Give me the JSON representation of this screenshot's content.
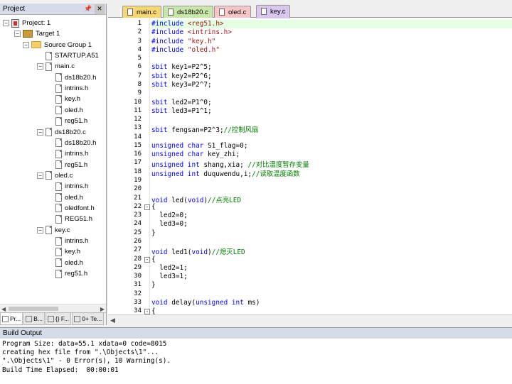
{
  "project_panel": {
    "title": "Project",
    "pin_icon": "pin-icon",
    "close_label": "✕",
    "tree": [
      {
        "label": "Project: 1",
        "type": "project",
        "level": 0,
        "expanded": true
      },
      {
        "label": "Target 1",
        "type": "target",
        "level": 1,
        "expanded": true
      },
      {
        "label": "Source Group 1",
        "type": "folder",
        "level": 2,
        "expanded": true
      },
      {
        "label": "STARTUP.A51",
        "type": "file",
        "level": 3
      },
      {
        "label": "main.c",
        "type": "file",
        "level": 3,
        "expanded": true
      },
      {
        "label": "ds18b20.h",
        "type": "file",
        "level": 4
      },
      {
        "label": "intrins.h",
        "type": "file",
        "level": 4
      },
      {
        "label": "key.h",
        "type": "file",
        "level": 4
      },
      {
        "label": "oled.h",
        "type": "file",
        "level": 4
      },
      {
        "label": "reg51.h",
        "type": "file",
        "level": 4
      },
      {
        "label": "ds18b20.c",
        "type": "file",
        "level": 3,
        "expanded": true
      },
      {
        "label": "ds18b20.h",
        "type": "file",
        "level": 4
      },
      {
        "label": "intrins.h",
        "type": "file",
        "level": 4
      },
      {
        "label": "reg51.h",
        "type": "file",
        "level": 4
      },
      {
        "label": "oled.c",
        "type": "file",
        "level": 3,
        "expanded": true
      },
      {
        "label": "intrins.h",
        "type": "file",
        "level": 4
      },
      {
        "label": "oled.h",
        "type": "file",
        "level": 4
      },
      {
        "label": "oledfont.h",
        "type": "file",
        "level": 4
      },
      {
        "label": "REG51.h",
        "type": "file",
        "level": 4
      },
      {
        "label": "key.c",
        "type": "file",
        "level": 3,
        "expanded": true
      },
      {
        "label": "intrins.h",
        "type": "file",
        "level": 4
      },
      {
        "label": "key.h",
        "type": "file",
        "level": 4
      },
      {
        "label": "oled.h",
        "type": "file",
        "level": 4
      },
      {
        "label": "reg51.h",
        "type": "file",
        "level": 4
      }
    ],
    "bottom_tabs": [
      {
        "label": "Pr...",
        "active": true
      },
      {
        "label": "B...",
        "active": false
      },
      {
        "label": "{} F...",
        "active": false
      },
      {
        "label": "0+ Te...",
        "active": false
      }
    ]
  },
  "editor": {
    "tabs": [
      {
        "label": "main.c",
        "color": "#f7d774",
        "active": false
      },
      {
        "label": "ds18b20.c",
        "color": "#c9e7a8",
        "active": false
      },
      {
        "label": "oled.c",
        "color": "#f8c6c6",
        "active": false
      },
      {
        "label": "key.c",
        "color": "#d9c7ef",
        "active": true
      }
    ],
    "lines": [
      {
        "n": "1",
        "t": [
          [
            "#include ",
            "kw"
          ],
          [
            "<reg51.h>",
            "str"
          ]
        ],
        "hl": true
      },
      {
        "n": "2",
        "t": [
          [
            "#include ",
            "kw"
          ],
          [
            "<intrins.h>",
            "str"
          ]
        ]
      },
      {
        "n": "3",
        "t": [
          [
            "#include ",
            "kw"
          ],
          [
            "\"key.h\"",
            "str"
          ]
        ]
      },
      {
        "n": "4",
        "t": [
          [
            "#include ",
            "kw"
          ],
          [
            "\"oled.h\"",
            "str"
          ]
        ]
      },
      {
        "n": "5",
        "t": []
      },
      {
        "n": "6",
        "t": [
          [
            "sbit ",
            "kw"
          ],
          [
            "key1=P2^5;",
            ""
          ]
        ]
      },
      {
        "n": "7",
        "t": [
          [
            "sbit ",
            "kw"
          ],
          [
            "key2=P2^6;",
            ""
          ]
        ]
      },
      {
        "n": "8",
        "t": [
          [
            "sbit ",
            "kw"
          ],
          [
            "key3=P2^7;",
            ""
          ]
        ]
      },
      {
        "n": "9",
        "t": []
      },
      {
        "n": "10",
        "t": [
          [
            "sbit ",
            "kw"
          ],
          [
            "led2=P1^0;",
            ""
          ]
        ]
      },
      {
        "n": "11",
        "t": [
          [
            "sbit ",
            "kw"
          ],
          [
            "led3=P1^1;",
            ""
          ]
        ]
      },
      {
        "n": "12",
        "t": []
      },
      {
        "n": "13",
        "t": [
          [
            "sbit ",
            "kw"
          ],
          [
            "fengsan=P2^3;",
            ""
          ],
          [
            "//控制风扇",
            "cmt"
          ]
        ]
      },
      {
        "n": "14",
        "t": []
      },
      {
        "n": "15",
        "t": [
          [
            "unsigned char ",
            "kw"
          ],
          [
            "S1_flag=0;",
            ""
          ]
        ]
      },
      {
        "n": "16",
        "t": [
          [
            "unsigned char ",
            "kw"
          ],
          [
            "key_zhi;",
            ""
          ]
        ]
      },
      {
        "n": "17",
        "t": [
          [
            "unsigned int ",
            "kw"
          ],
          [
            "shang,xia; ",
            ""
          ],
          [
            "//对比温度暂存变量",
            "cmt"
          ]
        ]
      },
      {
        "n": "18",
        "t": [
          [
            "unsigned int ",
            "kw"
          ],
          [
            "duquwendu,i;",
            ""
          ],
          [
            "//读取温度函数",
            "cmt"
          ]
        ]
      },
      {
        "n": "19",
        "t": []
      },
      {
        "n": "20",
        "t": []
      },
      {
        "n": "21",
        "t": [
          [
            "void ",
            "kw"
          ],
          [
            "led(",
            ""
          ],
          [
            "void",
            "kw"
          ],
          [
            ")",
            ""
          ],
          [
            "//点亮LED",
            "cmt"
          ]
        ]
      },
      {
        "n": "22",
        "t": [
          [
            "{",
            ""
          ]
        ],
        "fold": "-"
      },
      {
        "n": "23",
        "t": [
          [
            "  led2=0;",
            ""
          ]
        ]
      },
      {
        "n": "24",
        "t": [
          [
            "  led3=0;",
            ""
          ]
        ]
      },
      {
        "n": "25",
        "t": [
          [
            "}",
            ""
          ]
        ]
      },
      {
        "n": "26",
        "t": []
      },
      {
        "n": "27",
        "t": [
          [
            "void ",
            "kw"
          ],
          [
            "led1(",
            ""
          ],
          [
            "void",
            "kw"
          ],
          [
            ")",
            ""
          ],
          [
            "//熄灭LED",
            "cmt"
          ]
        ]
      },
      {
        "n": "28",
        "t": [
          [
            "{",
            ""
          ]
        ],
        "fold": "-"
      },
      {
        "n": "29",
        "t": [
          [
            "  led2=1;",
            ""
          ]
        ]
      },
      {
        "n": "30",
        "t": [
          [
            "  led3=1;",
            ""
          ]
        ]
      },
      {
        "n": "31",
        "t": [
          [
            "}",
            ""
          ]
        ]
      },
      {
        "n": "32",
        "t": []
      },
      {
        "n": "33",
        "t": [
          [
            "void ",
            "kw"
          ],
          [
            "delay(",
            ""
          ],
          [
            "unsigned int ",
            "kw"
          ],
          [
            "ms)",
            ""
          ]
        ]
      },
      {
        "n": "34",
        "t": [
          [
            "{",
            ""
          ]
        ],
        "fold": "-"
      }
    ]
  },
  "build_output": {
    "title": "Build Output",
    "lines": [
      "Program Size: data=55.1 xdata=0 code=8015",
      "creating hex file from \".\\Objects\\1\"...",
      "\".\\Objects\\1\" - 0 Error(s), 10 Warning(s).",
      "Build Time Elapsed:  00:00:01"
    ]
  }
}
